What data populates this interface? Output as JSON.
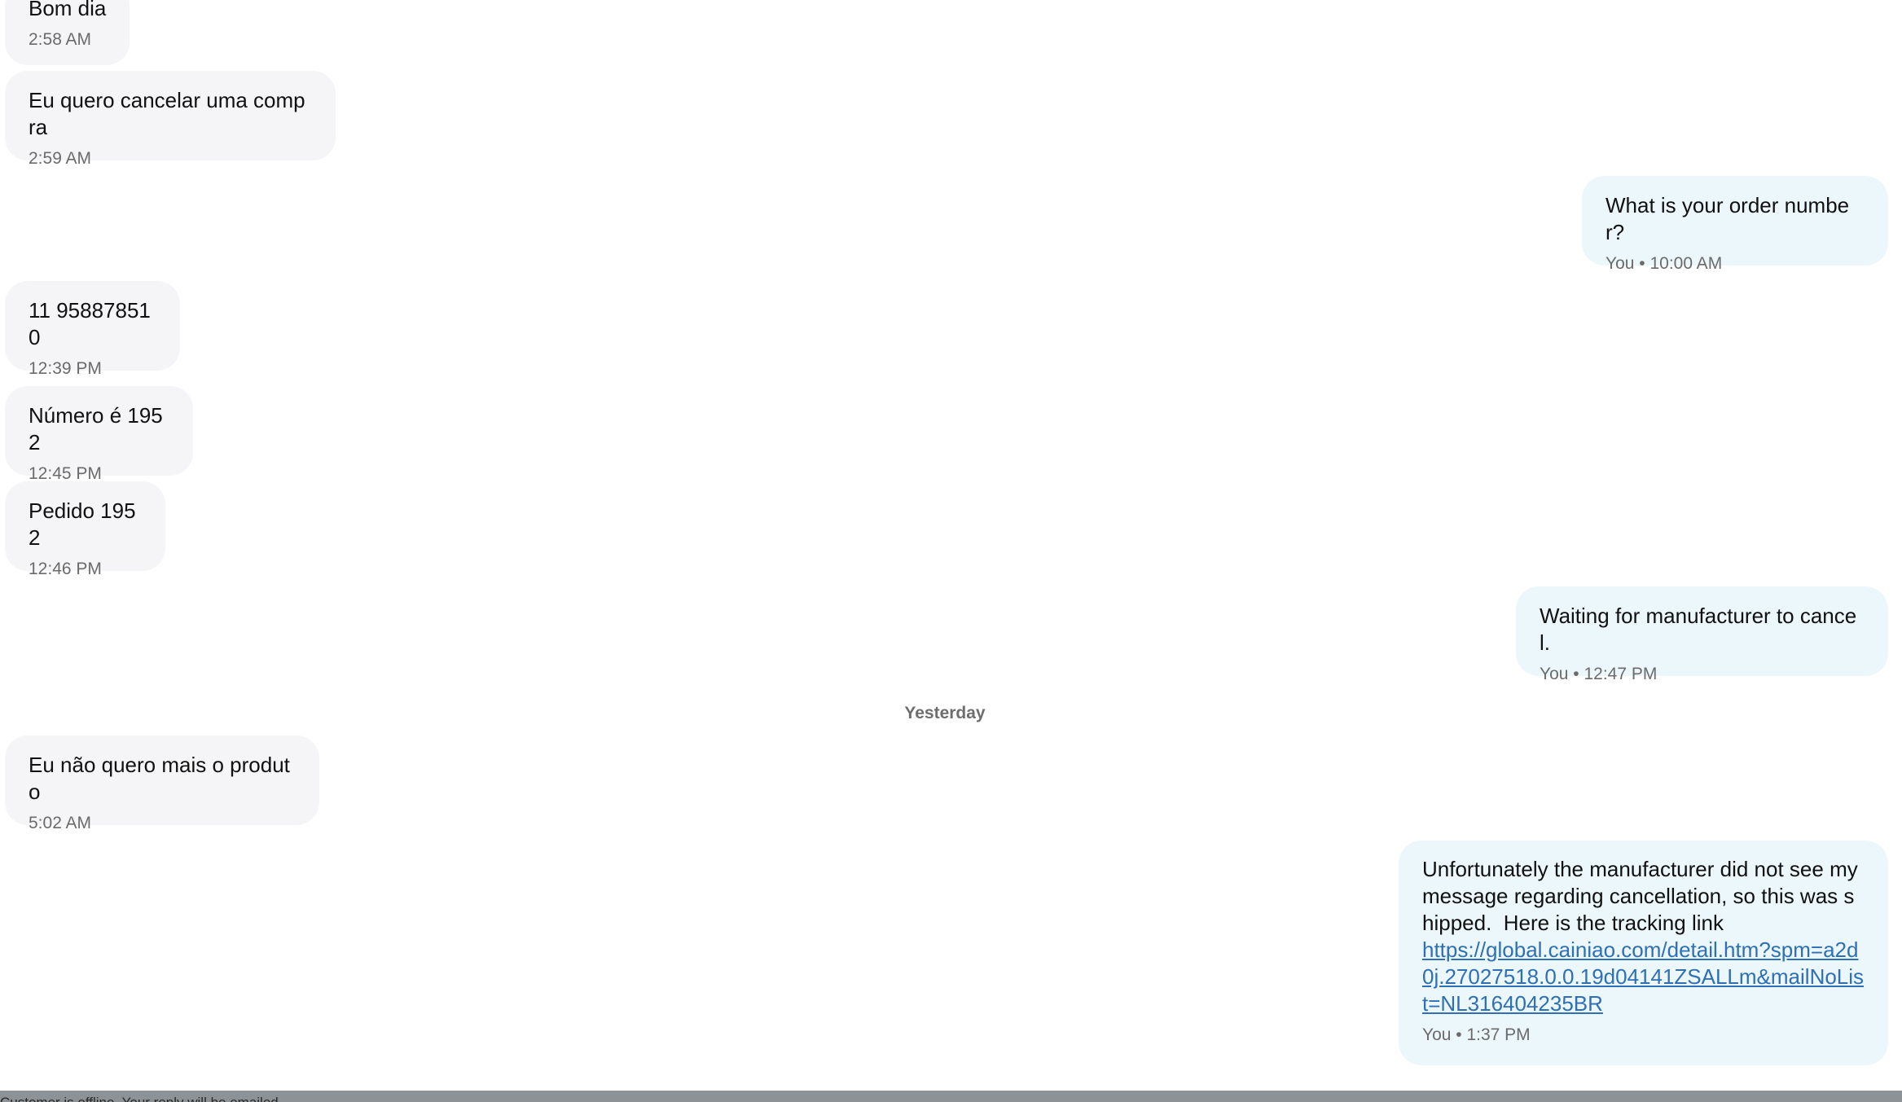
{
  "messages": [
    {
      "text": "Bom dia",
      "meta": "2:58 AM"
    },
    {
      "text": "Eu quero cancelar uma compra",
      "meta": "2:59 AM"
    },
    {
      "text": "What is your order number?",
      "meta": "You • 10:00 AM"
    },
    {
      "text": "11 958878510",
      "meta": "12:39 PM"
    },
    {
      "text": "Número é 1952",
      "meta": "12:45 PM"
    },
    {
      "text": "Pedido 1952",
      "meta": "12:46 PM"
    },
    {
      "text": "Waiting for manufacturer to cancel.",
      "meta": "You • 12:47 PM"
    },
    {
      "text": "Eu não quero mais o produto",
      "meta": "5:02 AM"
    },
    {
      "text": "Unfortunately the manufacturer did not see my message regarding cancellation, so this was shipped.  Here is the tracking link",
      "link": "https://global.cainiao.com/detail.htm?spm=a2d0j.27027518.0.0.19d04141ZSALLm&mailNoList=NL316404235BR",
      "meta": "You • 1:37 PM"
    }
  ],
  "divider": "Yesterday",
  "status_bar": {
    "text": "Customer is offline. Your reply will be emailed."
  }
}
